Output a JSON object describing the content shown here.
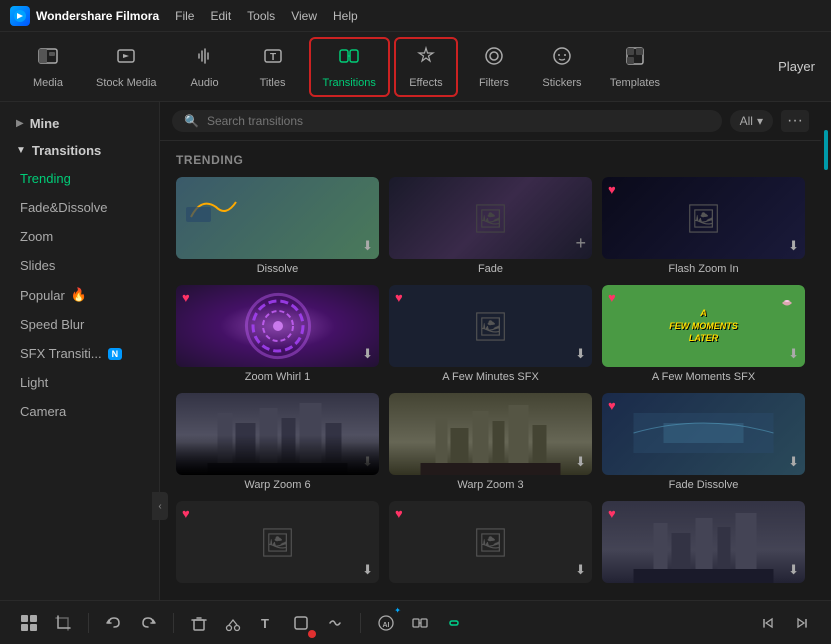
{
  "app": {
    "title": "Wondershare Filmora",
    "logo_text": "W"
  },
  "menubar": {
    "items": [
      "File",
      "Edit",
      "Tools",
      "View",
      "Help"
    ]
  },
  "toolbar": {
    "items": [
      {
        "id": "media",
        "label": "Media",
        "icon": "▣"
      },
      {
        "id": "stock-media",
        "label": "Stock Media",
        "icon": "🎬"
      },
      {
        "id": "audio",
        "label": "Audio",
        "icon": "♪"
      },
      {
        "id": "titles",
        "label": "Titles",
        "icon": "T"
      },
      {
        "id": "transitions",
        "label": "Transitions",
        "icon": "⊞",
        "active": true
      },
      {
        "id": "effects",
        "label": "Effects",
        "icon": "✦"
      },
      {
        "id": "filters",
        "label": "Filters",
        "icon": "◎"
      },
      {
        "id": "stickers",
        "label": "Stickers",
        "icon": "😊"
      },
      {
        "id": "templates",
        "label": "Templates",
        "icon": "⬜"
      }
    ],
    "player_label": "Player"
  },
  "sidebar": {
    "mine_label": "Mine",
    "transitions_label": "Transitions",
    "items": [
      {
        "id": "trending",
        "label": "Trending",
        "active": true
      },
      {
        "id": "fade-dissolve",
        "label": "Fade&Dissolve"
      },
      {
        "id": "zoom",
        "label": "Zoom"
      },
      {
        "id": "slides",
        "label": "Slides"
      },
      {
        "id": "popular",
        "label": "Popular",
        "badge": "fire"
      },
      {
        "id": "speed-blur",
        "label": "Speed Blur"
      },
      {
        "id": "sfx-transitions",
        "label": "SFX Transiti...",
        "badge": "new"
      },
      {
        "id": "light",
        "label": "Light"
      },
      {
        "id": "camera",
        "label": "Camera"
      }
    ]
  },
  "search": {
    "placeholder": "Search transitions",
    "filter_label": "All"
  },
  "grid": {
    "section_title": "TRENDING",
    "items": [
      {
        "id": "dissolve",
        "label": "Dissolve",
        "style": "dissolve",
        "has_heart": false,
        "has_plus": false,
        "has_download": true
      },
      {
        "id": "fade",
        "label": "Fade",
        "style": "fade",
        "has_heart": false,
        "has_plus": true,
        "has_download": false
      },
      {
        "id": "flash-zoom-in",
        "label": "Flash Zoom In",
        "style": "flashzoom",
        "has_heart": true,
        "has_plus": false,
        "has_download": true
      },
      {
        "id": "zoom-whirl-1",
        "label": "Zoom Whirl 1",
        "style": "zoomwhirl",
        "has_heart": true,
        "has_plus": false,
        "has_download": true
      },
      {
        "id": "few-minutes-sfx",
        "label": "A Few Minutes SFX",
        "style": "fewminutes",
        "has_heart": true,
        "has_plus": false,
        "has_download": true
      },
      {
        "id": "few-moments-sfx",
        "label": "A Few Moments SFX",
        "style": "fewmoments",
        "has_heart": true,
        "has_plus": false,
        "has_download": true
      },
      {
        "id": "warp-zoom-6",
        "label": "Warp Zoom 6",
        "style": "warpzoom6",
        "has_heart": false,
        "has_plus": false,
        "has_download": true
      },
      {
        "id": "warp-zoom-3",
        "label": "Warp Zoom 3",
        "style": "warpzoom3",
        "has_heart": false,
        "has_plus": false,
        "has_download": true
      },
      {
        "id": "fade-dissolve",
        "label": "Fade Dissolve",
        "style": "fadedissolve",
        "has_heart": true,
        "has_plus": false,
        "has_download": true
      },
      {
        "id": "generic-1",
        "label": "",
        "style": "generic",
        "has_heart": true,
        "has_plus": false,
        "has_download": true
      },
      {
        "id": "generic-2",
        "label": "",
        "style": "generic",
        "has_heart": true,
        "has_plus": false,
        "has_download": true
      },
      {
        "id": "generic-3",
        "label": "",
        "style": "city",
        "has_heart": true,
        "has_plus": false,
        "has_download": true
      }
    ]
  },
  "bottom_toolbar": {
    "buttons": [
      "grid-view",
      "crop-tool",
      "separator",
      "undo",
      "redo",
      "separator",
      "delete",
      "cut",
      "text",
      "record",
      "ripple",
      "separator",
      "audio-connect",
      "media-connect",
      "link"
    ]
  }
}
